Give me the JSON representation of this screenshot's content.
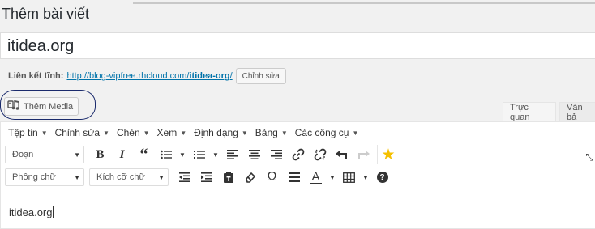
{
  "header": {
    "title": "Thêm bài viết"
  },
  "post": {
    "title_value": "itidea.org",
    "permalink": {
      "label": "Liên kết tĩnh:",
      "url_prefix": "http://blog-vipfree.rhcloud.com/",
      "slug": "itidea-org",
      "url_suffix": "/",
      "edit_label": "Chỉnh sửa"
    }
  },
  "media": {
    "add_label": "Thêm Media"
  },
  "editor_tabs": {
    "visual": "Trực quan",
    "text": "Văn bả"
  },
  "menubar": {
    "items": [
      {
        "label": "Tệp tin"
      },
      {
        "label": "Chỉnh sửa"
      },
      {
        "label": "Chèn"
      },
      {
        "label": "Xem"
      },
      {
        "label": "Định dạng"
      },
      {
        "label": "Bảng"
      },
      {
        "label": "Các công cụ"
      }
    ]
  },
  "toolbar": {
    "format_select": "Đoạn",
    "font_select": "Phông chữ",
    "size_select": "Kích cỡ chữ",
    "special_char": "Ω",
    "underline_a": "A"
  },
  "content": {
    "text": "itidea.org"
  },
  "colors": {
    "link": "#0073aa",
    "star": "#f5c000",
    "ring": "#1a2a6c"
  }
}
